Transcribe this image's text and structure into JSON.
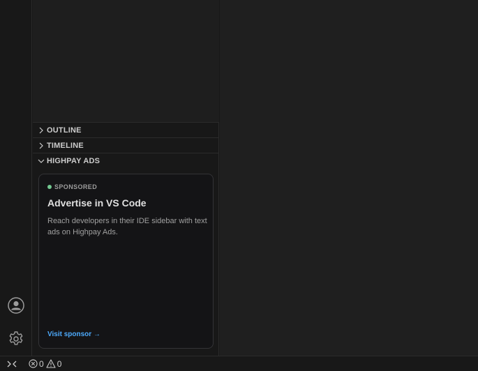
{
  "sidebar": {
    "sections": [
      {
        "label": "OUTLINE",
        "expanded": false
      },
      {
        "label": "TIMELINE",
        "expanded": false
      },
      {
        "label": "HIGHPAY ADS",
        "expanded": true
      }
    ]
  },
  "ad": {
    "badge": "SPONSORED",
    "title": "Advertise in VS Code",
    "description": "Reach developers in their IDE sidebar with text ads on Highpay Ads.",
    "link": "Visit sponsor →",
    "badge_color": "#73c991",
    "link_color": "#4daafc"
  },
  "activity_bar": {
    "icons": [
      "account-icon",
      "gear-icon"
    ]
  },
  "status_bar": {
    "errors": "0",
    "warnings": "0"
  }
}
